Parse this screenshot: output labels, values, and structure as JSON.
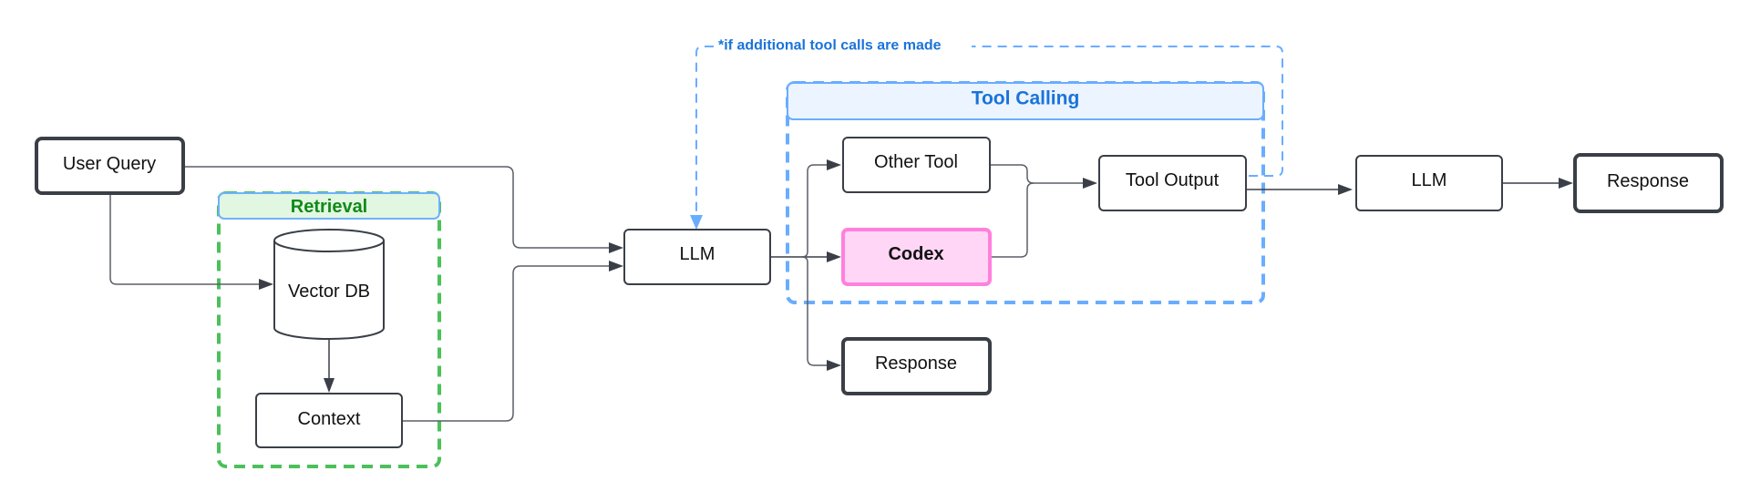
{
  "diagram": {
    "nodes": {
      "user_query": "User Query",
      "vector_db": "Vector DB",
      "context": "Context",
      "llm_1": "LLM",
      "other_tool": "Other Tool",
      "codex": "Codex",
      "tool_output": "Tool Output",
      "response_direct": "Response",
      "llm_2": "LLM",
      "response_final": "Response"
    },
    "groups": {
      "retrieval": "Retrieval",
      "tool_calling": "Tool Calling"
    },
    "loop_label": "*if additional tool calls are made",
    "edges": [
      {
        "from": "User Query",
        "to": "LLM"
      },
      {
        "from": "User Query",
        "to": "Vector DB"
      },
      {
        "from": "Vector DB",
        "to": "Context"
      },
      {
        "from": "Context",
        "to": "LLM"
      },
      {
        "from": "LLM",
        "to": "Other Tool"
      },
      {
        "from": "LLM",
        "to": "Codex"
      },
      {
        "from": "LLM",
        "to": "Response"
      },
      {
        "from": "Other Tool",
        "to": "Tool Output"
      },
      {
        "from": "Codex",
        "to": "Tool Output"
      },
      {
        "from": "Tool Output",
        "to": "LLM",
        "style": "dashed",
        "label": "*if additional tool calls are made"
      },
      {
        "from": "Tool Output",
        "to": "LLM (final)"
      },
      {
        "from": "LLM (final)",
        "to": "Response (final)"
      }
    ],
    "colors": {
      "retrieval_border": "#4cc05a",
      "retrieval_header_fill": "#e2f7e2",
      "retrieval_title": "#118a18",
      "tool_calling_border": "#6aadff",
      "tool_calling_header_fill": "#ebf4ff",
      "tool_calling_title": "#1a73d9",
      "codex_fill": "#ffd6f5",
      "codex_border": "#ff80dc",
      "node_border": "#3a3f47"
    }
  }
}
